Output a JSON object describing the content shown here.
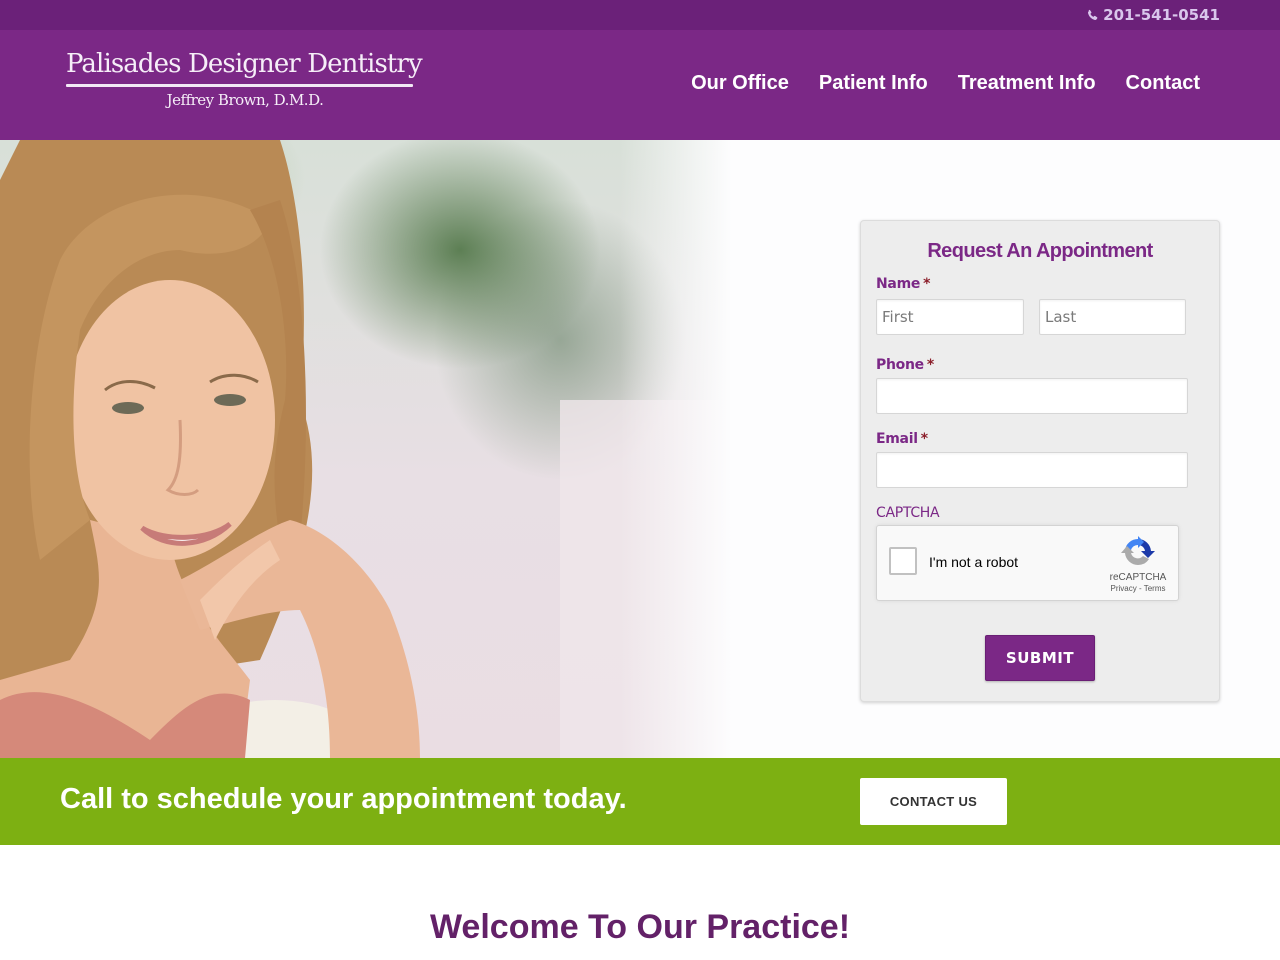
{
  "topbar": {
    "phone_icon": "phone-icon",
    "phone": "201-541-0541"
  },
  "header": {
    "logo": {
      "title": "Palisades Designer Dentistry",
      "subtitle": "Jeffrey Brown, D.M.D."
    },
    "nav": [
      {
        "label": "Our Office"
      },
      {
        "label": "Patient Info"
      },
      {
        "label": "Treatment Info"
      },
      {
        "label": "Contact"
      }
    ]
  },
  "hero": {
    "image_alt": "Smiling woman resting chin on hand"
  },
  "appointment_form": {
    "title": "Request An Appointment",
    "name_label": "Name",
    "required_mark": "*",
    "first_placeholder": "First",
    "last_placeholder": "Last",
    "first_value": "",
    "last_value": "",
    "phone_label": "Phone",
    "phone_value": "",
    "email_label": "Email",
    "email_value": "",
    "captcha_label": "CAPTCHA",
    "captcha": {
      "checkbox_text": "I'm not a robot",
      "checked": false,
      "brand": "reCAPTCHA",
      "privacy": "Privacy",
      "separator": " - ",
      "terms": "Terms"
    },
    "submit_label": "SUBMIT"
  },
  "cta": {
    "message": "Call to schedule your appointment today.",
    "button_label": "CONTACT US"
  },
  "welcome": {
    "heading": "Welcome To Our Practice!"
  },
  "colors": {
    "brand_purple": "#7b2886",
    "topbar_purple": "#6b2179",
    "cta_green": "#7db012",
    "heading_purple": "#632168"
  }
}
